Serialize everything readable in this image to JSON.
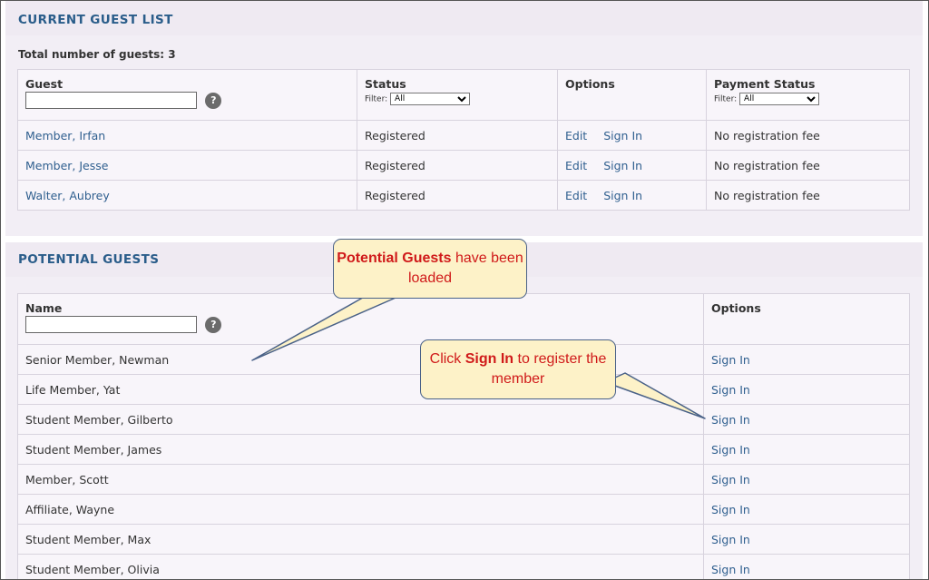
{
  "current_guests": {
    "title": "CURRENT GUEST LIST",
    "total": "Total number of guests: 3",
    "columns": {
      "guest": "Guest",
      "status": "Status",
      "options": "Options",
      "payment": "Payment Status"
    },
    "filter_label": "Filter:",
    "status_filter_value": "All",
    "payment_filter_value": "All",
    "help_glyph": "?",
    "rows": [
      {
        "name": "Member, Irfan",
        "status": "Registered",
        "edit": "Edit",
        "signin": "Sign In",
        "payment": "No registration fee"
      },
      {
        "name": "Member, Jesse",
        "status": "Registered",
        "edit": "Edit",
        "signin": "Sign In",
        "payment": "No registration fee"
      },
      {
        "name": "Walter, Aubrey",
        "status": "Registered",
        "edit": "Edit",
        "signin": "Sign In",
        "payment": "No registration fee"
      }
    ]
  },
  "potential_guests": {
    "title": "POTENTIAL GUESTS",
    "columns": {
      "name": "Name",
      "options": "Options"
    },
    "help_glyph": "?",
    "rows": [
      {
        "name": "Senior Member, Newman",
        "signin": "Sign In"
      },
      {
        "name": "Life Member, Yat",
        "signin": "Sign In"
      },
      {
        "name": "Student Member, Gilberto",
        "signin": "Sign In"
      },
      {
        "name": "Student Member, James",
        "signin": "Sign In"
      },
      {
        "name": "Member, Scott",
        "signin": "Sign In"
      },
      {
        "name": "Affiliate, Wayne",
        "signin": "Sign In"
      },
      {
        "name": "Student Member, Max",
        "signin": "Sign In"
      },
      {
        "name": "Student Member, Olivia",
        "signin": "Sign In"
      }
    ]
  },
  "callouts": {
    "loaded": {
      "bold": "Potential Guests",
      "rest": " have been loaded"
    },
    "signin": {
      "pre": "Click ",
      "bold": "Sign In",
      "rest": " to register the member"
    }
  },
  "colors": {
    "link": "#2f5f8f",
    "section_title": "#2a5d8a",
    "panel_bg": "#f2eef5",
    "callout_bg": "#fdf2c8",
    "callout_text": "#d01a1a",
    "callout_border": "#4a6288"
  },
  "icons": {
    "help": "question-circle-icon"
  }
}
